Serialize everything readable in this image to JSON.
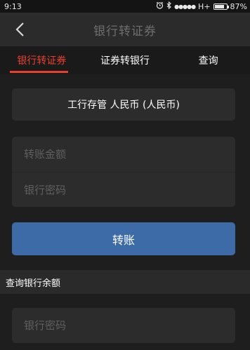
{
  "status_bar": {
    "time": "9:13",
    "signal": "●●●●●",
    "network": "H+",
    "battery": "87%",
    "battery_level": 0.87
  },
  "nav": {
    "title": "银行转证券",
    "back_icon": "chevron-left-icon"
  },
  "tabs": [
    {
      "label": "银行转证券",
      "active": true
    },
    {
      "label": "证券转银行",
      "active": false
    },
    {
      "label": "查询",
      "active": false
    }
  ],
  "account": {
    "text": "工行存管 人民币 (人民币)"
  },
  "form": {
    "amount_placeholder": "转账金额",
    "password_placeholder": "银行密码"
  },
  "transfer_button": {
    "label": "转账"
  },
  "balance_section": {
    "title": "查询银行余额",
    "password_placeholder": "银行密码"
  },
  "colors": {
    "accent_red": "#e8402f",
    "button_blue": "#3d6ba8",
    "background": "#1e1e1e"
  }
}
